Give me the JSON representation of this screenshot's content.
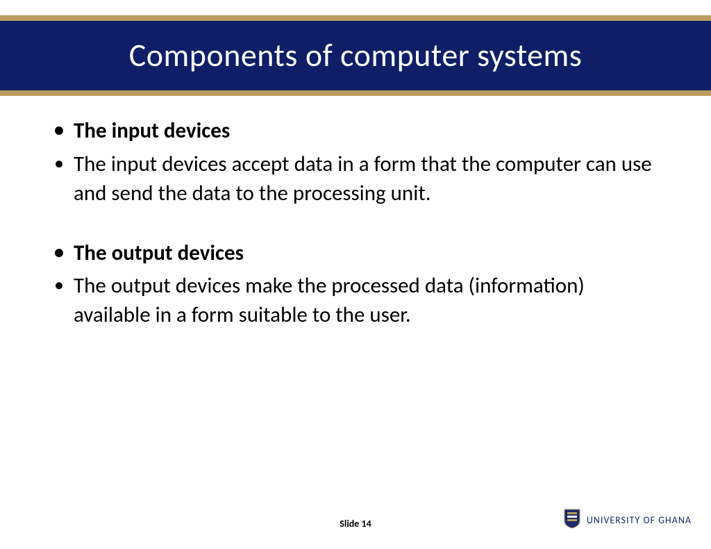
{
  "title": "Components of computer systems",
  "bullets": {
    "input_heading": "The input devices",
    "input_body": "The input devices accept data in a form that the computer can use and send the data to the processing unit.",
    "output_heading": "The output devices",
    "output_body": "The output devices make the processed data (information)  available in a form suitable to the user."
  },
  "footer": {
    "slide_label": "Slide 14",
    "university": "UNIVERSITY OF GHANA"
  },
  "colors": {
    "title_bg": "#0f1e66",
    "accent_border": "#b89b5e",
    "text": "#000000",
    "university_text": "#1a2a6c"
  }
}
